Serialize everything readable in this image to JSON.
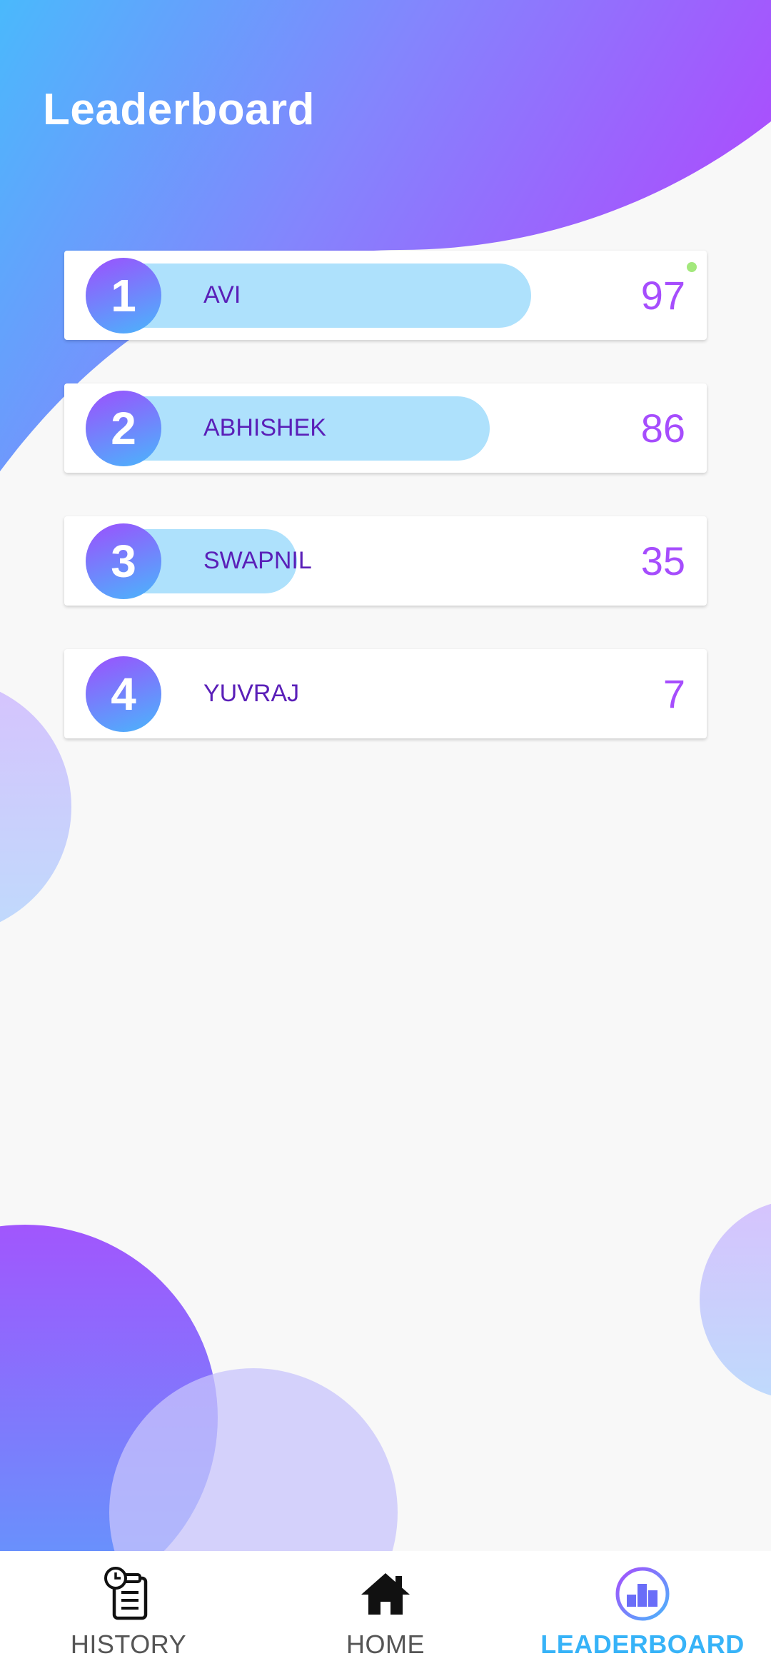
{
  "page": {
    "title": "Leaderboard"
  },
  "leaderboard": {
    "entries": [
      {
        "rank": "1",
        "name": "AVI",
        "score": "97",
        "progress": 0.97,
        "online": true
      },
      {
        "rank": "2",
        "name": "ABHISHEK",
        "score": "86",
        "progress": 0.86,
        "online": false
      },
      {
        "rank": "3",
        "name": "SWAPNIL",
        "score": "35",
        "progress": 0.35,
        "online": false
      },
      {
        "rank": "4",
        "name": "YUVRAJ",
        "score": "7",
        "progress": 0.07,
        "online": false
      }
    ]
  },
  "nav": {
    "items": [
      {
        "label": "HISTORY",
        "icon": "clipboard-clock-icon",
        "active": false
      },
      {
        "label": "HOME",
        "icon": "home-icon",
        "active": false
      },
      {
        "label": "LEADERBOARD",
        "icon": "leaderboard-icon",
        "active": true
      }
    ]
  },
  "colors": {
    "gradient_start": "#4ab5fb",
    "gradient_end": "#a64dfd",
    "progress_bar": "#aee1fc",
    "name_text": "#5a1fb8",
    "score_text": "#a64dfd",
    "online_indicator": "#a3e87c",
    "nav_active": "#37b3f8",
    "nav_inactive": "#555555"
  }
}
